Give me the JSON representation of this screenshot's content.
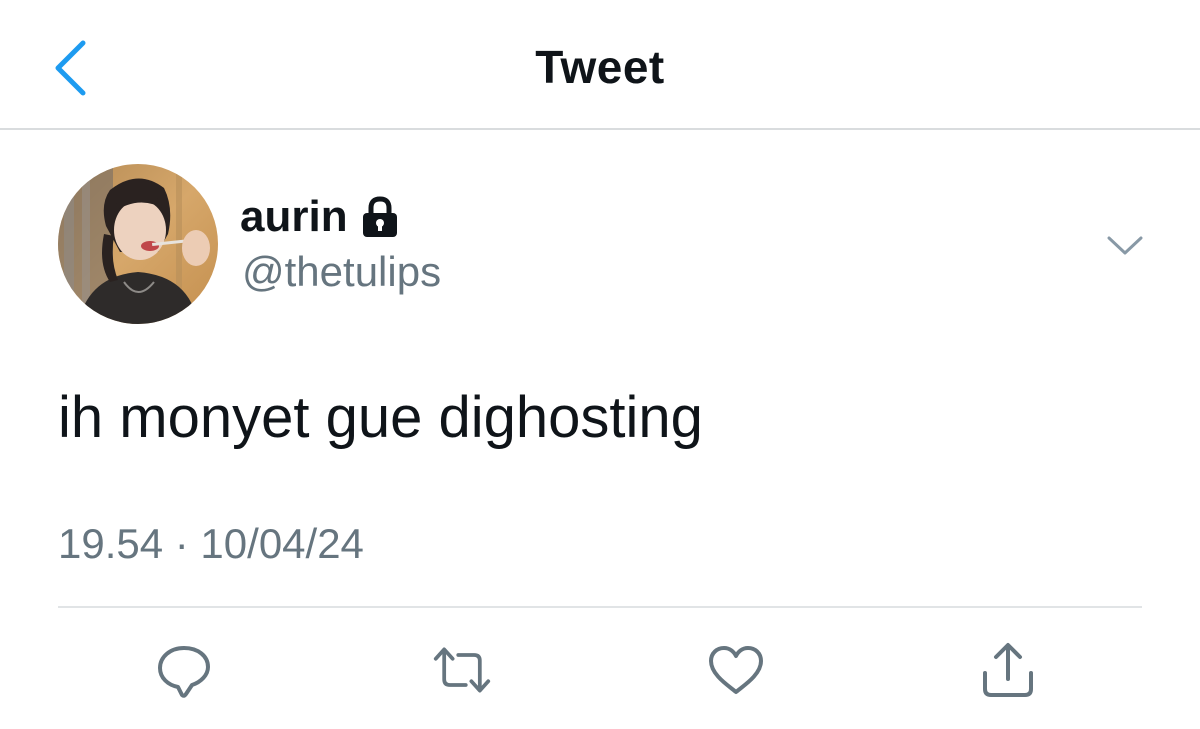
{
  "header": {
    "title": "Tweet",
    "back_icon": "chevron-left-icon"
  },
  "author": {
    "display_name": "aurin",
    "protected_icon": "lock-icon",
    "handle": "@thetulips",
    "menu_icon": "chevron-down-icon"
  },
  "tweet": {
    "text": "ih monyet gue dighosting",
    "timestamp": "19.54 · 10/04/24"
  },
  "actions": [
    {
      "name": "reply",
      "icon": "reply-icon"
    },
    {
      "name": "retweet",
      "icon": "retweet-icon"
    },
    {
      "name": "like",
      "icon": "heart-icon"
    },
    {
      "name": "share",
      "icon": "share-icon"
    }
  ],
  "colors": {
    "accent": "#1d9bf0",
    "text": "#0f1419",
    "secondary": "#66757f",
    "divider": "#e1e4e6"
  }
}
